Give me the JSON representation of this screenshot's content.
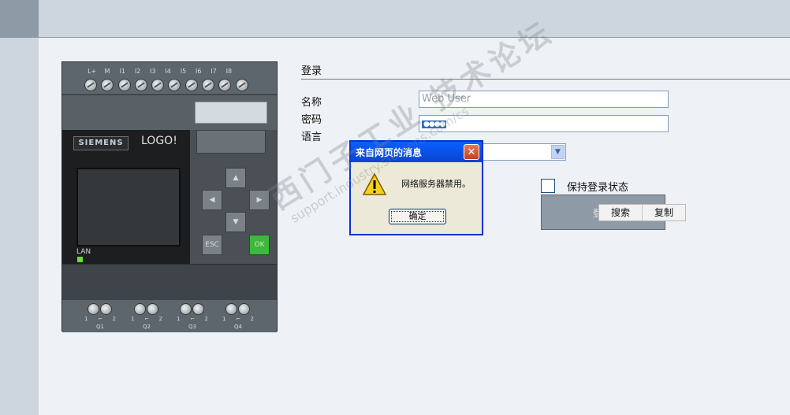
{
  "device": {
    "terminals_top": [
      "L+",
      "M",
      "I1",
      "I2",
      "I3",
      "I4",
      "I5",
      "I6",
      "I7",
      "I8"
    ],
    "brand": "SIEMENS",
    "model": "LOGO!",
    "lan_label": "LAN",
    "keys": {
      "esc": "ESC",
      "ok": "OK"
    },
    "outputs": [
      {
        "label": "Q1",
        "pin1": "1",
        "pin2": "2"
      },
      {
        "label": "Q2",
        "pin1": "1",
        "pin2": "2"
      },
      {
        "label": "Q3",
        "pin1": "1",
        "pin2": "2"
      },
      {
        "label": "Q4",
        "pin1": "1",
        "pin2": "2"
      }
    ]
  },
  "login": {
    "title": "登录",
    "name_label": "名称",
    "name_placeholder": "Web User",
    "password_label": "密码",
    "password_value": "●●●●",
    "language_label": "语言",
    "language_value": "",
    "remember_label": "保持登录状态",
    "remember_checked": false,
    "login_button_text": "登"
  },
  "context_menu": {
    "items": [
      "搜索",
      "复制"
    ]
  },
  "dialog": {
    "title": "来自网页的消息",
    "message": "网络服务器禁用。",
    "ok_label": "确定",
    "icon": "warning-icon"
  },
  "watermark": {
    "text_cn": "西门子工业 技术论坛",
    "url": "support.industry.siemens.com/cs"
  },
  "colors": {
    "topbar": "#cdd6df",
    "dialog_title": "#0a5fff",
    "ok_key": "#3cb83a"
  }
}
